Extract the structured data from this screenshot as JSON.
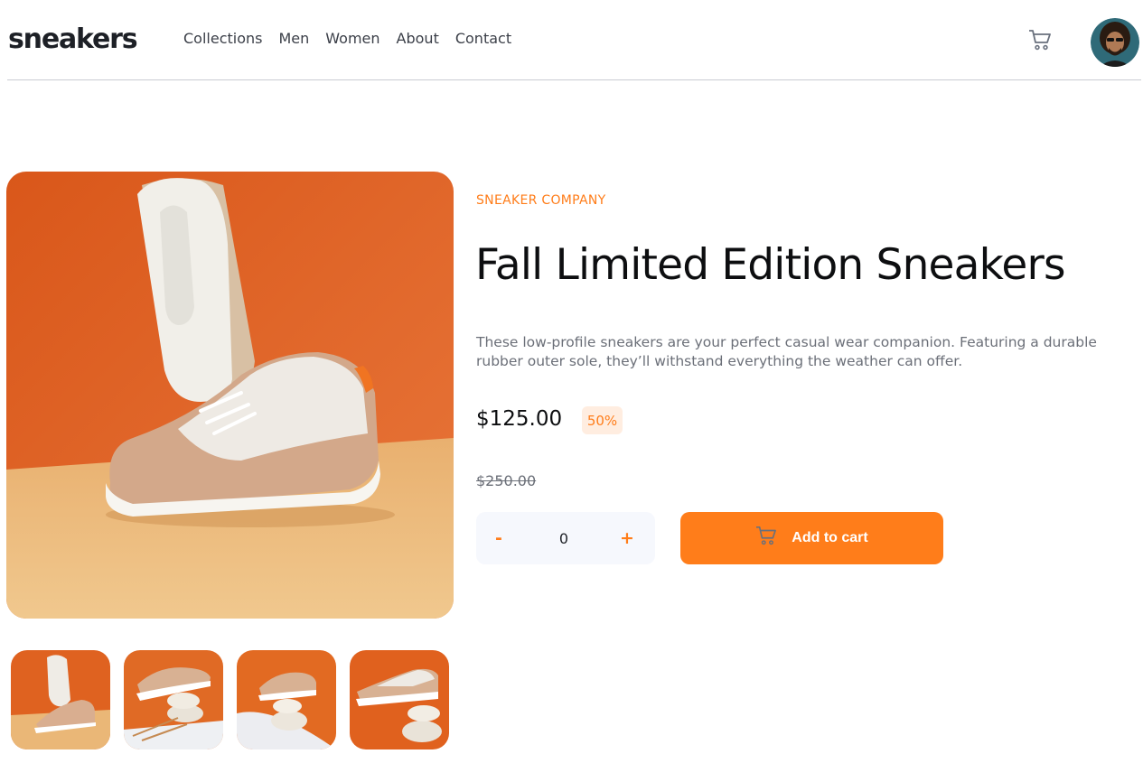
{
  "header": {
    "logo": "sneakers",
    "nav": [
      "Collections",
      "Men",
      "Women",
      "About",
      "Contact"
    ],
    "cart_icon": "cart-icon",
    "avatar_icon": "user-avatar"
  },
  "gallery": {
    "thumbnails": [
      "thumbnail-1",
      "thumbnail-2",
      "thumbnail-3",
      "thumbnail-4"
    ]
  },
  "product": {
    "company": "SNEAKER COMPANY",
    "title": "Fall Limited Edition Sneakers",
    "description": "These low-profile sneakers are your perfect casual wear companion. Featuring a durable rubber outer sole, they’ll withstand everything the weather can offer.",
    "price": "$125.00",
    "discount": "50%",
    "original_price": "$250.00"
  },
  "cart_controls": {
    "minus": "-",
    "quantity": "0",
    "plus": "+",
    "add_to_cart": "Add to cart"
  },
  "colors": {
    "accent": "#ff7d1a",
    "accent_pale": "#ffede0",
    "text_dark": "#1d2026",
    "text_muted": "#6b6f78"
  }
}
